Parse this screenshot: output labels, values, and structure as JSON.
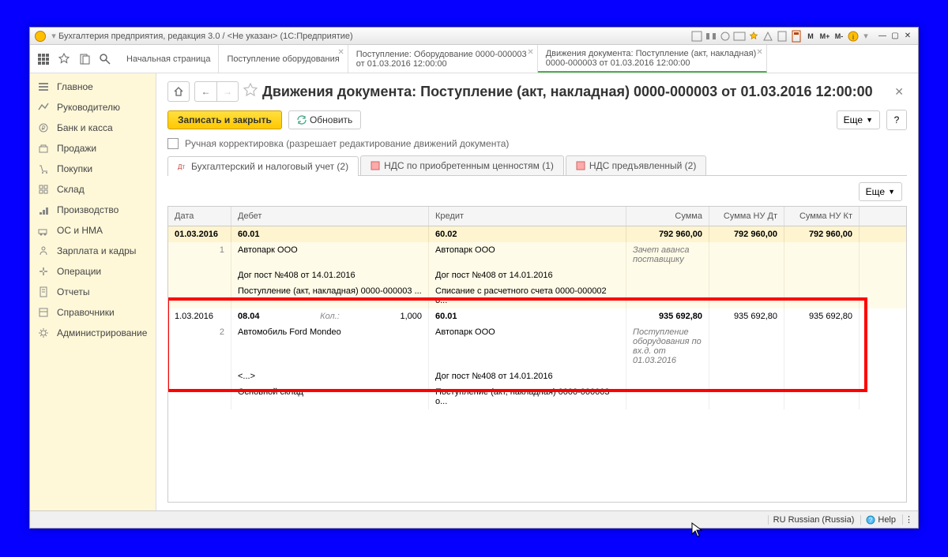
{
  "window": {
    "title": "Бухгалтерия предприятия, редакция 3.0 / <Не указан>  (1С:Предприятие)"
  },
  "tabs": [
    {
      "label": "Начальная страница",
      "line2": ""
    },
    {
      "label": "Поступление оборудования",
      "line2": ""
    },
    {
      "label": "Поступление: Оборудование 0000-000003",
      "line2": "от 01.03.2016 12:00:00"
    },
    {
      "label": "Движения документа: Поступление (акт, накладная)",
      "line2": "0000-000003 от 01.03.2016 12:00:00"
    }
  ],
  "sidebar": [
    {
      "id": "main",
      "label": "Главное"
    },
    {
      "id": "manager",
      "label": "Руководителю"
    },
    {
      "id": "bank",
      "label": "Банк и касса"
    },
    {
      "id": "sales",
      "label": "Продажи"
    },
    {
      "id": "purchases",
      "label": "Покупки"
    },
    {
      "id": "stock",
      "label": "Склад"
    },
    {
      "id": "production",
      "label": "Производство"
    },
    {
      "id": "assets",
      "label": "ОС и НМА"
    },
    {
      "id": "salary",
      "label": "Зарплата и кадры"
    },
    {
      "id": "operations",
      "label": "Операции"
    },
    {
      "id": "reports",
      "label": "Отчеты"
    },
    {
      "id": "refs",
      "label": "Справочники"
    },
    {
      "id": "admin",
      "label": "Администрирование"
    }
  ],
  "doc": {
    "title": "Движения документа: Поступление (акт, накладная) 0000-000003 от 01.03.2016 12:00:00",
    "save_close": "Записать и закрыть",
    "refresh": "Обновить",
    "more": "Еще",
    "help": "?",
    "manual_edit": "Ручная корректировка (разрешает редактирование движений документа)"
  },
  "subtabs": [
    {
      "label": "Бухгалтерский и налоговый учет (2)"
    },
    {
      "label": "НДС по приобретенным ценностям (1)"
    },
    {
      "label": "НДС предъявленный (2)"
    }
  ],
  "grid": {
    "more": "Еще",
    "headers": {
      "date": "Дата",
      "debit": "Дебет",
      "credit": "Кредит",
      "sum": "Сумма",
      "sumdt": "Сумма НУ Дт",
      "sumkt": "Сумма НУ Кт"
    },
    "rows": [
      {
        "type": "head",
        "date": "01.03.2016",
        "debit": "60.01",
        "credit": "60.02",
        "sum": "792 960,00",
        "sumdt": "792 960,00",
        "sumkt": "792 960,00"
      },
      {
        "type": "sub",
        "idx": "1",
        "debit": "Автопарк ООО",
        "credit": "Автопарк ООО",
        "note": "Зачет аванса поставщику"
      },
      {
        "type": "sub",
        "debit": "Дог пост №408 от 14.01.2016",
        "credit": "Дог пост №408 от 14.01.2016"
      },
      {
        "type": "sub",
        "debit": "Поступление (акт, накладная) 0000-000003 ...",
        "credit": "Списание с расчетного счета 0000-000002 о..."
      },
      {
        "type": "head2",
        "date": "1.03.2016",
        "debit": "08.04",
        "kol_label": "Кол.:",
        "kol": "1,000",
        "credit": "60.01",
        "sum": "935 692,80",
        "sumdt": "935 692,80",
        "sumkt": "935 692,80"
      },
      {
        "type": "plain",
        "idx": "2",
        "debit": "Автомобиль Ford Mondeo",
        "credit": "Автопарк ООО",
        "note": "Поступление оборудования по вх.д.   от 01.03.2016"
      },
      {
        "type": "plain",
        "debit": "<...>",
        "credit": "Дог пост №408 от 14.01.2016"
      },
      {
        "type": "plain",
        "debit": "Основной склад",
        "credit": "Поступление (акт, накладная) 0000-000003 о..."
      }
    ]
  },
  "status": {
    "lang": "RU Russian (Russia)",
    "help": "Help"
  }
}
